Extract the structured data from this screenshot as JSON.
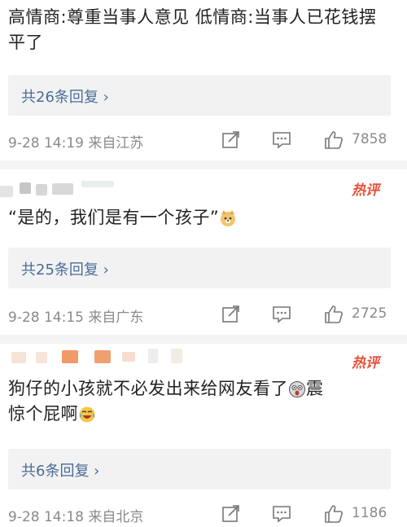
{
  "comments": [
    {
      "text": "高情商:尊重当事人意见 低情商:当事人已花钱摆平了",
      "reply_label": "共26条回复 ›",
      "time": "9-28 14:19 来自江苏",
      "likes": "7858"
    },
    {
      "text": "“是的，我们是有一个孩子”",
      "emoji": "doge",
      "reply_label": "共25条回复 ›",
      "time": "9-28 14:15 来自广东",
      "likes": "2725",
      "badge": "热评"
    },
    {
      "text_line1": "狗仔的小孩就不必发出来给网友看了",
      "text_line1_end": "震",
      "text_line2": "惊个屁啊",
      "emoji_1": "shocked-face",
      "emoji_2": "laugh-crying-face",
      "reply_label": "共6条回复 ›",
      "time": "9-28 14:18 来自北京",
      "likes": "1186",
      "badge": "热评"
    }
  ],
  "icons": [
    "share-icon",
    "comment-icon",
    "like-icon"
  ],
  "colors": {
    "link": "#4a6c99",
    "badge": "#e8503a",
    "meta": "#8a8a8a",
    "reply_bg": "#f2f2f2"
  }
}
